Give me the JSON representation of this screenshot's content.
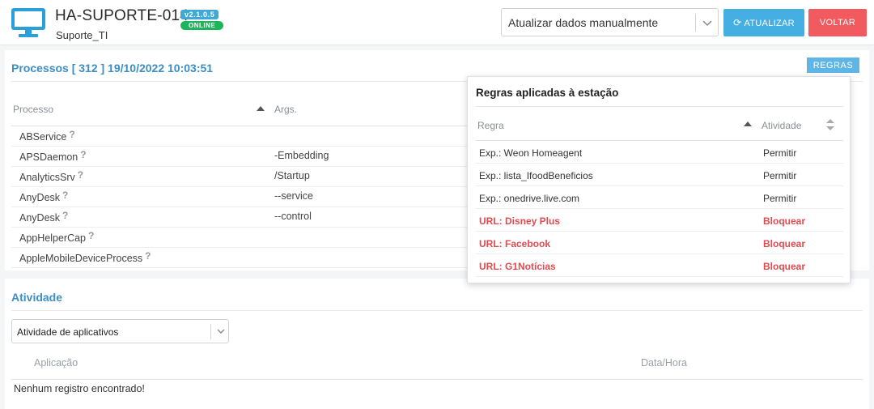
{
  "header": {
    "host_name": "HA-SUPORTE-014",
    "version": "v2.1.0.5",
    "status": "ONLINE",
    "group": "Suporte_TI",
    "update_select": "Atualizar dados manualmente",
    "update_button": "ATUALIZAR",
    "back_button": "VOLTAR"
  },
  "processes": {
    "title": "Processos [ 312 ] 19/10/2022 10:03:51",
    "rules_button": "REGRAS",
    "col_process": "Processo",
    "col_args": "Args.",
    "rows": [
      {
        "name": "ABService",
        "args": ""
      },
      {
        "name": "APSDaemon",
        "args": "-Embedding"
      },
      {
        "name": "AnalyticsSrv",
        "args": "/Startup"
      },
      {
        "name": "AnyDesk",
        "args": "--service"
      },
      {
        "name": "AnyDesk",
        "args": "--control"
      },
      {
        "name": "AppHelperCap",
        "args": ""
      },
      {
        "name": "AppleMobileDeviceProcess",
        "args": ""
      }
    ]
  },
  "rules_popover": {
    "title": "Regras aplicadas à estação",
    "col_rule": "Regra",
    "col_activity": "Atividade",
    "rows": [
      {
        "rule": "Exp.: Weon Homeagent",
        "action": "Permitir",
        "blocked": false
      },
      {
        "rule": "Exp.: lista_IfoodBeneficios",
        "action": "Permitir",
        "blocked": false
      },
      {
        "rule": "Exp.: onedrive.live.com",
        "action": "Permitir",
        "blocked": false
      },
      {
        "rule": "URL: Disney Plus",
        "action": "Bloquear",
        "blocked": true
      },
      {
        "rule": "URL: Facebook",
        "action": "Bloquear",
        "blocked": true
      },
      {
        "rule": "URL: G1Notícias",
        "action": "Bloquear",
        "blocked": true
      }
    ]
  },
  "activity": {
    "title": "Atividade",
    "filter_select": "Atividade de aplicativos",
    "col_app": "Aplicação",
    "col_datetime": "Data/Hora",
    "empty_message": "Nenhum registro encontrado!"
  },
  "colors": {
    "accent": "#3c8ec4",
    "update_button": "#45aee2",
    "back_button": "#f15a5f",
    "online": "#1cb55a",
    "blocked": "#e24a4f"
  },
  "icons": {
    "station": "monitor-icon",
    "update": "sync-icon",
    "help": "question-icon"
  }
}
